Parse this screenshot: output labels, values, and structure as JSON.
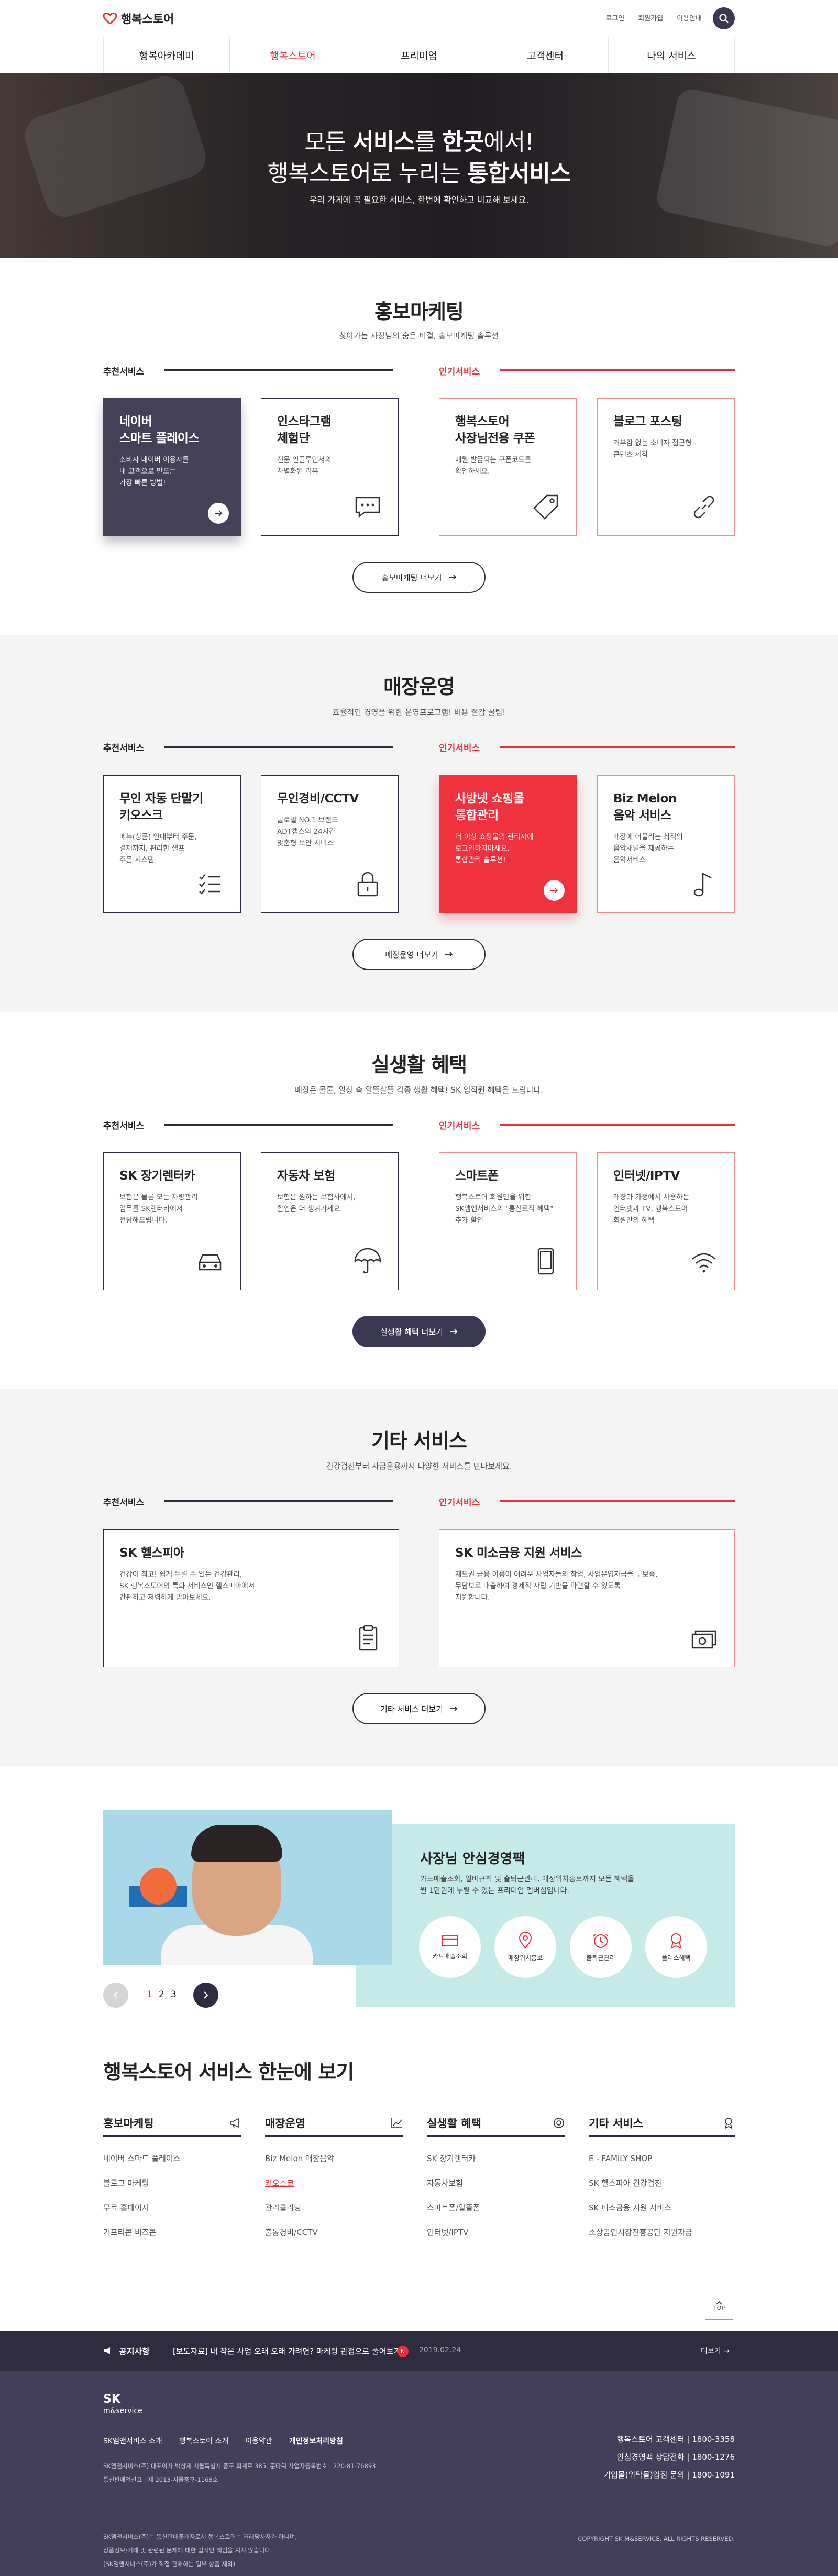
{
  "brand": {
    "name": "행복스토어",
    "accent": "#e8313c",
    "navy": "#2e2c3e"
  },
  "util": {
    "login": "로그인",
    "join": "회원가입",
    "guide": "이용안내"
  },
  "nav": [
    "행복아카데미",
    "행복스토어",
    "프리미엄",
    "고객센터",
    "나의 서비스"
  ],
  "hero": {
    "line1_a": "모든 ",
    "line1_b": "서비스",
    "line1_c": "를 ",
    "line1_d": "한곳",
    "line1_e": "에서!",
    "line2_a": "행복스토어로 누리는 ",
    "line2_b": "통합서비스",
    "sub": "우리 가게에 꼭 필요한 서비스, 한번에 확인하고 비교해 보세요."
  },
  "labels": {
    "rec": "추천서비스",
    "pop": "인기서비스"
  },
  "sections": [
    {
      "title": "홍보마케팅",
      "desc": "찾아가는 사장님의 숨은 비결, 홍보마케팅 솔루션",
      "more": "홍보마케팅 더보기",
      "cards": [
        {
          "title": "네이버\n스마트 플레이스",
          "desc": "소비자 네이버 이용자를\n내 고객으로 만드는\n가장 빠른 방법!"
        },
        {
          "title": "인스타그램\n체험단",
          "desc": "전문 인플루언서의\n차별화된 리뷰"
        },
        {
          "title": "행복스토어\n사장님전용 쿠폰",
          "desc": "매월 발급되는 쿠폰코드를\n확인하세요."
        },
        {
          "title": "블로그 포스팅",
          "desc": "거부감 없는 소비자 접근형\n콘텐츠 제작"
        }
      ]
    },
    {
      "title": "매장운영",
      "desc": "효율적인 경영을 위한 운영프로그램! 비용 절감 꿀팁!",
      "more": "매장운영 더보기",
      "cards": [
        {
          "title": "무인 자동 단말기\n키오스크",
          "desc": "메뉴(상품) 안내부터 주문,\n결제까지, 편리한 셀프\n주문 시스템"
        },
        {
          "title": "무인경비/CCTV",
          "desc": "글로벌 NO.1 브랜드\nADT캡스의 24시간\n맞춤형 보안 서비스"
        },
        {
          "title": "사방넷 쇼핑몰\n통합관리",
          "desc": "더 이상 쇼핑몰의 관리자에\n로그인하지마세요.\n통합관리 솔루션!"
        },
        {
          "title": "Biz Melon\n음악 서비스",
          "desc": "매장에 어울리는 최적의\n음악채널을 제공하는\n음악서비스"
        }
      ]
    },
    {
      "title": "실생활 혜택",
      "desc": "매장은 물론, 일상 속 알뜰살뜰 각종 생활 혜택! SK 임직원 혜택을 드립니다.",
      "more": "실생활 혜택 더보기",
      "cards": [
        {
          "title": "SK 장기렌터카",
          "desc": "보험은 물론 모든 차량관리\n업무를 SK렌터카에서\n전담해드립니다."
        },
        {
          "title": "자동차 보험",
          "desc": "보험은 원하는 보험사에서,\n할인은 더 챙겨가세요."
        },
        {
          "title": "스마트폰",
          "desc": "행복스토어 회원만을 위한\nSK엠앤서비스의 \"통신료적 혜택\"\n추가 할인"
        },
        {
          "title": "인터넷/IPTV",
          "desc": "매장과 가정에서 사용하는\n인터넷과 TV, 행복스토어\n회원만의 혜택"
        }
      ]
    },
    {
      "title": "기타 서비스",
      "desc": "건강검진부터 자금운용까지 다양한 서비스를 만나보세요.",
      "more": "기타 서비스 더보기",
      "cards": [
        {
          "title": "SK 헬스피아",
          "desc": "건강이 최고! 쉽게 누릴 수 있는 건강관리,\nSK 행복스토어의 특화 서비스인 헬스피아에서\n간편하고 저렴하게 받아보세요."
        },
        {
          "title": "SK 미소금융 지원 서비스",
          "desc": "제도권 금융 이용이 어려운 사업자들의 창업, 사업운영자금을 무보증,\n무담보로 대출하여 경제적 자립 기반을 마련할 수 있도록\n지원합니다."
        }
      ]
    }
  ],
  "banner": {
    "title": "사장님 안심경영팩",
    "desc": "카드매출조회, 일바규칙 및 출퇴근관리, 매장위치홍보까지 모든 혜택을\n월 1만원에 누릴 수 있는 프리미엄 멤버십입니다.",
    "items": [
      "카드매출조회",
      "매장위치홍보",
      "출퇴근관리",
      "플러스혜택"
    ],
    "pages": [
      "1",
      "2",
      "3"
    ]
  },
  "overview": {
    "title": "행복스토어 서비스 한눈에 보기",
    "cols": [
      {
        "head": "홍보마케팅",
        "items": [
          "네이버 스마트 플레이스",
          "블로그 마케팅",
          "무료 홈페이지",
          "기프티콘 비즈콘"
        ]
      },
      {
        "head": "매장운영",
        "items": [
          "Biz Melon 매장음악",
          "키오스크",
          "관리클리닝",
          "출동경비/CCTV"
        ]
      },
      {
        "head": "실생활 혜택",
        "items": [
          "SK 장기렌터카",
          "자동차보험",
          "스마트폰/알뜰폰",
          "인터넷/IPTV"
        ]
      },
      {
        "head": "기타 서비스",
        "items": [
          "E - FAMILY SHOP",
          "SK 헬스피아 건강검진",
          "SK 미소금융 지원 서비스",
          "소상공인시장진흥공단 지원자금"
        ]
      }
    ]
  },
  "top_label": "TOP",
  "notice": {
    "label": "공지사항",
    "text": "[보도자료] 내 작은 사업 오래 오래 가려면? 마케팅 관점으로 풀어보기",
    "new": "N",
    "date": "2019.02.24",
    "more": "더보기"
  },
  "footer": {
    "logo": "SK",
    "logo_sub": "m&service",
    "links": [
      "SK엠앤서비스 소개",
      "행복스토어 소개",
      "이용약관",
      "개인정보처리방침"
    ],
    "info": "SK엠앤서비스(주) 대표이사 박상재    서울특별시 중구 퇴계로 385, 준타워    사업자등록번호 : 220-81-76893\n통신판매업신고 : 제 2013-서울중구-1168호",
    "info2": "SK엠앤서비스(주)는 통신판매중개자로서 행복스토어는 거래당사자가 아니며,\n상품정보/거래 및 관련된 문제에 대한 법적인 책임을 지지 않습니다.\n(SK엠앤서비스(주)가 직접 판매하는 일부 상품 제외)",
    "contacts": [
      "행복스토어 고객센터 | 1800-3358",
      "안심경영팩 상담전화 | 1800-1276",
      "기업몰(위탁몰)입점 문의 | 1800-1091"
    ],
    "copy": "COPYRIGHT SK M&SERVICE. ALL RIGHTS RESERVED."
  }
}
